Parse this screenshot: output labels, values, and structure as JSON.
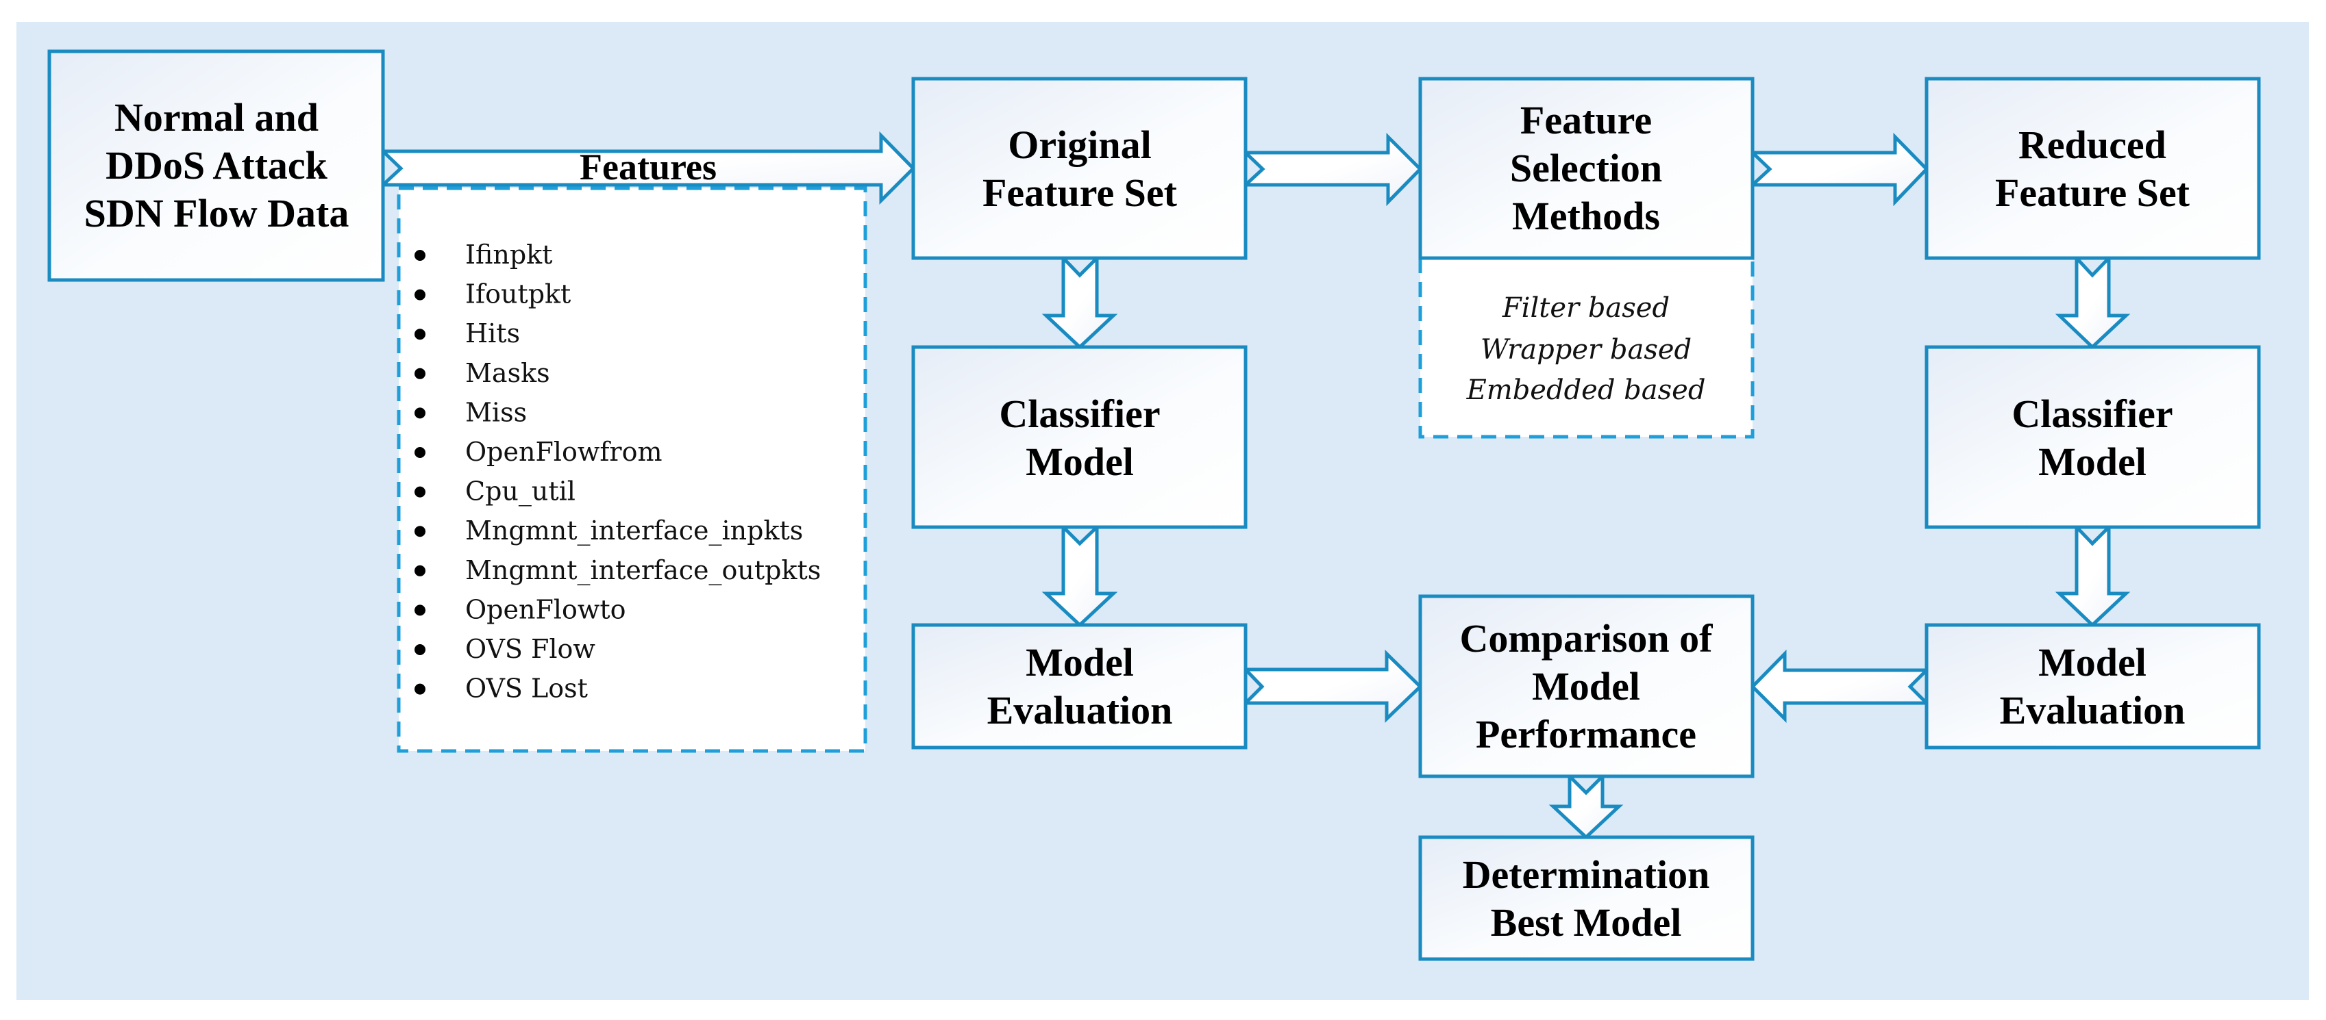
{
  "colors": {
    "panel_background": "#dbeaf6",
    "box_border": "#1a8bc1",
    "dashed_border": "#1f9fd9",
    "text": "#000000"
  },
  "nodes": {
    "source": {
      "lines": [
        "Normal and",
        "DDoS Attack",
        "SDN Flow Data"
      ]
    },
    "original_feature_set": {
      "lines": [
        "Original",
        "Feature Set"
      ]
    },
    "feature_selection": {
      "lines": [
        "Feature",
        "Selection",
        "Methods"
      ],
      "methods": [
        "Filter based",
        "Wrapper based",
        "Embedded based"
      ]
    },
    "reduced_feature_set": {
      "lines": [
        "Reduced",
        "Feature Set"
      ]
    },
    "classifier_left": {
      "lines": [
        "Classifier",
        "Model"
      ]
    },
    "classifier_right": {
      "lines": [
        "Classifier",
        "Model"
      ]
    },
    "evaluation_left": {
      "lines": [
        "Model",
        "Evaluation"
      ]
    },
    "evaluation_right": {
      "lines": [
        "Model",
        "Evaluation"
      ]
    },
    "comparison": {
      "lines": [
        "Comparison of",
        "Model",
        "Performance"
      ]
    },
    "determination": {
      "lines": [
        "Determination",
        "Best Model"
      ]
    }
  },
  "features_arrow": {
    "label": "Features"
  },
  "features_list": [
    "Ifinpkt",
    "Ifoutpkt",
    "Hits",
    "Masks",
    "Miss",
    "OpenFlowfrom",
    "Cpu_util",
    "Mngmnt_interface_inpkts",
    "Mngmnt_interface_outpkts",
    "OpenFlowto",
    "OVS Flow",
    "OVS Lost"
  ],
  "edges": [
    {
      "from": "source",
      "to": "original_feature_set",
      "label": "Features"
    },
    {
      "from": "original_feature_set",
      "to": "feature_selection"
    },
    {
      "from": "feature_selection",
      "to": "reduced_feature_set"
    },
    {
      "from": "original_feature_set",
      "to": "classifier_left"
    },
    {
      "from": "reduced_feature_set",
      "to": "classifier_right"
    },
    {
      "from": "classifier_left",
      "to": "evaluation_left"
    },
    {
      "from": "classifier_right",
      "to": "evaluation_right"
    },
    {
      "from": "evaluation_left",
      "to": "comparison"
    },
    {
      "from": "evaluation_right",
      "to": "comparison"
    },
    {
      "from": "comparison",
      "to": "determination"
    }
  ]
}
